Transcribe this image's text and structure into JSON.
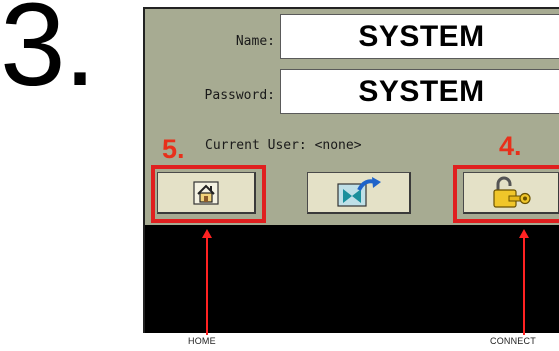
{
  "step": {
    "number": "3."
  },
  "login": {
    "name_label": "Name:",
    "name_value": "SYSTEM",
    "password_label": "Password:",
    "password_value": "SYSTEM",
    "current_user_text": "Current User: <none>"
  },
  "buttons": {
    "home": {
      "icon": "home-icon"
    },
    "logout": {
      "icon": "logout-arrow-icon"
    },
    "connect": {
      "icon": "padlock-key-icon"
    }
  },
  "callouts": {
    "home_number": "5.",
    "connect_number": "4.",
    "home_label": "HOME",
    "connect_label": "CONNECT"
  },
  "colors": {
    "panel_background": "#a7ab92",
    "button_face": "#e4e1c7",
    "highlight": "#e01f1f",
    "callout_text": "#e8301b"
  }
}
